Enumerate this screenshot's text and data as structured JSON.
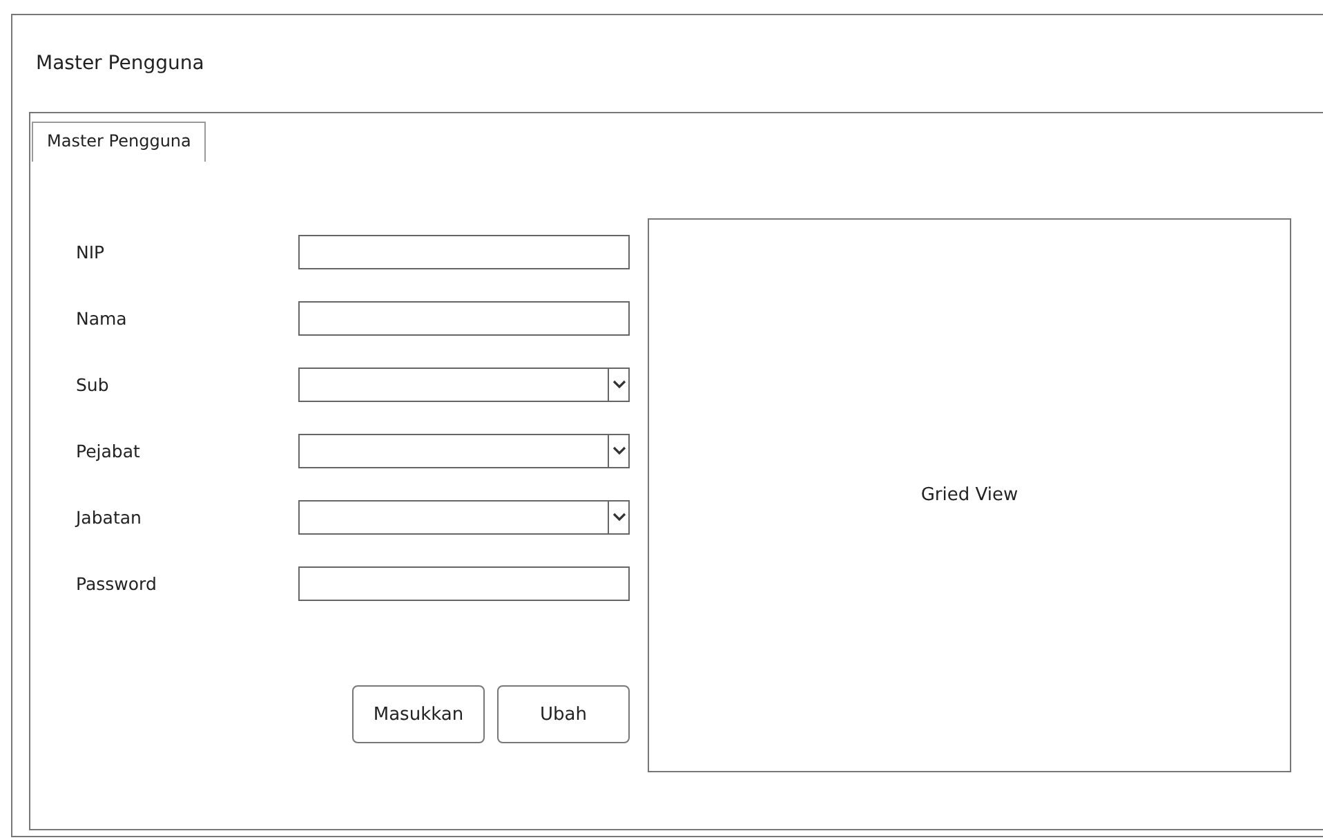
{
  "window": {
    "title": "Master Pengguna"
  },
  "tabs": [
    {
      "label": "Master Pengguna",
      "selected": true
    }
  ],
  "form": {
    "fields": [
      {
        "label": "NIP",
        "kind": "text"
      },
      {
        "label": "Nama",
        "kind": "text"
      },
      {
        "label": "Sub",
        "kind": "dropdown"
      },
      {
        "label": "Pejabat",
        "kind": "dropdown"
      },
      {
        "label": "Jabatan",
        "kind": "dropdown"
      },
      {
        "label": "Password",
        "kind": "text"
      }
    ],
    "buttons": [
      "Masukkan",
      "Ubah"
    ]
  },
  "grid_view": {
    "label": "Gried View"
  }
}
